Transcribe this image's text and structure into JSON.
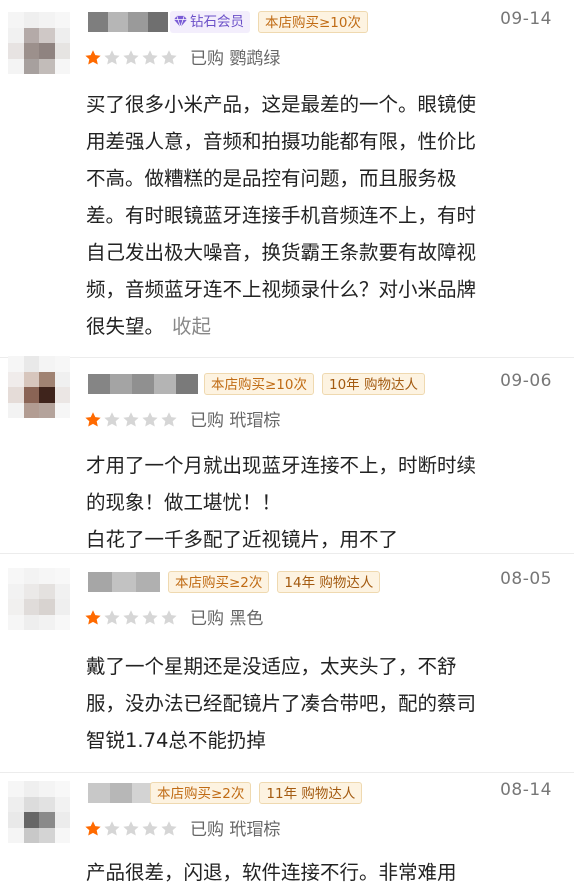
{
  "reviews": [
    {
      "badges": {
        "member": "钻石会员",
        "shop": "本店购买≥10次",
        "talent": ""
      },
      "date": "09-14",
      "rating": 1,
      "variant": "已购 鹦鹉绿",
      "text_lines": [
        "买了很多小米产品，这是最差的一个。眼镜使",
        "用差强人意，音频和拍摄功能都有限，性价比",
        "不高。做糟糕的是品控有问题，而且服务极",
        "差。有时眼镜蓝牙连接手机音频连不上，有时",
        "自己发出极大噪音，换货霸王条款要有故障视",
        "频，音频蓝牙连不上视频录什么？对小米品牌",
        "很失望。"
      ],
      "collapse_label": "收起"
    },
    {
      "badges": {
        "member": "",
        "shop": "本店购买≥10次",
        "talent": "10年 购物达人"
      },
      "date": "09-06",
      "rating": 1,
      "variant": "已购 玳瑁棕",
      "text_lines": [
        "才用了一个月就出现蓝牙连接不上，时断时续",
        "的现象！做工堪忧！！",
        "白花了一千多配了近视镜片，用不了"
      ],
      "collapse_label": ""
    },
    {
      "badges": {
        "member": "",
        "shop": "本店购买≥2次",
        "talent": "14年 购物达人"
      },
      "date": "08-05",
      "rating": 1,
      "variant": "已购 黑色",
      "text_lines": [
        "戴了一个星期还是没适应，太夹头了，不舒",
        "服，没办法已经配镜片了凑合带吧，配的蔡司",
        "智锐1.74总不能扔掉"
      ],
      "collapse_label": ""
    },
    {
      "badges": {
        "member": "",
        "shop": "本店购买≥2次",
        "talent": "11年 购物达人"
      },
      "date": "08-14",
      "rating": 1,
      "variant": "已购 玳瑁棕",
      "text_lines": [
        "产品很差，闪退，软件连接不行。非常难用"
      ],
      "collapse_label": ""
    }
  ],
  "colors": {
    "star_active": "#ff6a00",
    "star_inactive": "#d6d6d6",
    "accent_badge": "#c06b14"
  }
}
